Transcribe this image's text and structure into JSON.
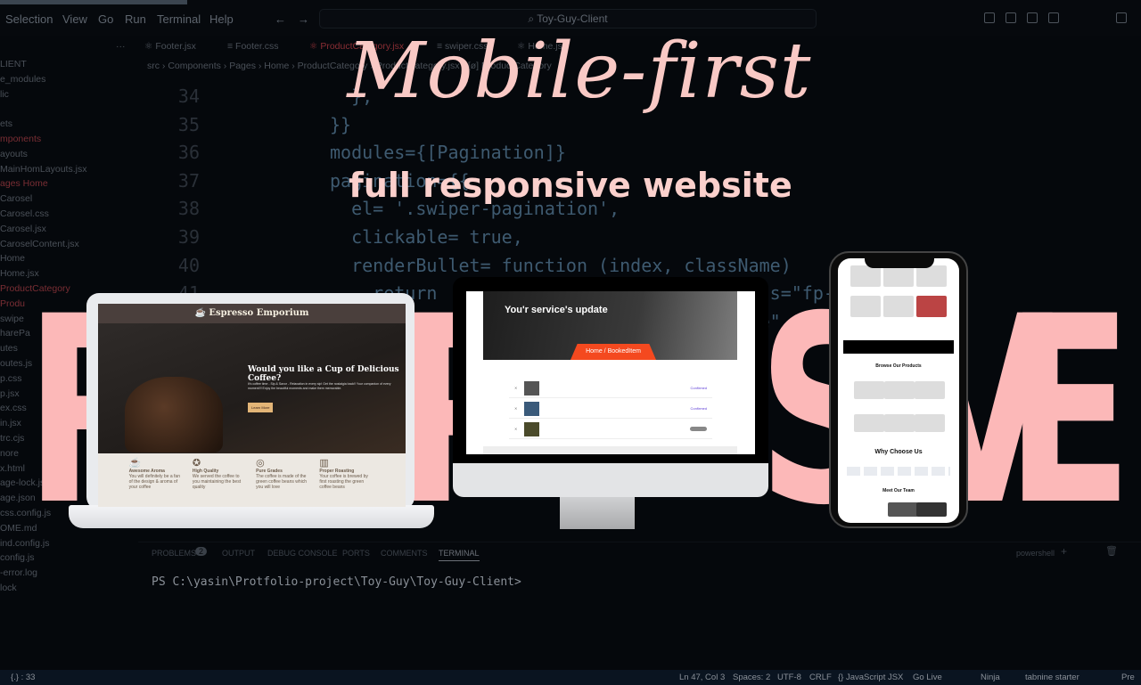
{
  "titlebar": {
    "menu": [
      "Selection",
      "View",
      "Go",
      "Run",
      "Terminal",
      "Help"
    ],
    "search": "Toy-Guy-Client"
  },
  "sidebar": {
    "more": "···",
    "items": [
      "LIENT",
      "e_modules",
      "lic",
      "",
      "ets",
      "mponents",
      "ayouts",
      "MainHomLayouts.jsx",
      "ages  Home",
      "Carosel",
      "Carosel.css",
      "Carosel.jsx",
      "CaroselContent.jsx",
      "Home",
      "Home.jsx",
      "ProductCategory",
      "Produ",
      "swipe",
      "harePa",
      "utes",
      "outes.js",
      "p.css",
      "p.jsx",
      "ex.css",
      "in.jsx",
      "trc.cjs",
      "nore",
      "x.html",
      "age-lock.json",
      "age.json",
      "css.config.js",
      "OME.md",
      "ind.config.js",
      "config.js",
      "-error.log",
      "lock"
    ]
  },
  "tabs": [
    "Footer.jsx",
    "Footer.css",
    "ProductCategory.jsx",
    "swiper.css",
    "Home.jsx"
  ],
  "breadcrumb": "src › Components › Pages › Home › ProductCategory › ProductCategory.jsx › [ø] ProductCategory",
  "code": {
    "lines": [
      "34",
      "35",
      "36",
      "37",
      "38",
      "39",
      "40",
      "41"
    ],
    "text": [
      "  },",
      "}}",
      "modules={[Pagination]}",
      "pagination={{",
      "  el= '.swiper-pagination',",
      "  clickable= true,",
      "  renderBullet= function (index, className)",
      "    return                   + '\">       s=\"fp-arc-loa",
      "    <cir                 \"8\" r=      none\" transfo",
      "                             op",
      "    cl                       FFF\"><",
      "    </",
      "",
      "  me=\"         "
    ]
  },
  "panel": {
    "tabs": [
      "PROBLEMS",
      "OUTPUT",
      "DEBUG CONSOLE",
      "PORTS",
      "COMMENTS",
      "TERMINAL"
    ],
    "problems_count": "2",
    "shell": "powershell",
    "prompt": "PS C:\\yasin\\Protfolio-project\\Toy-Guy\\Toy-Guy-Client>"
  },
  "status": {
    "left": "{.} : 33",
    "items": [
      "Ln 47, Col 3",
      "Spaces: 2",
      "UTF-8",
      "CRLF",
      "{} JavaScript JSX",
      "Go Live",
      "Ninja",
      "tabnine starter",
      "Pre"
    ]
  },
  "promo": {
    "headline": "Mobile-first",
    "subheadline": "full responsive website",
    "big_letters": [
      "R",
      "P",
      "S",
      "V",
      "E"
    ]
  },
  "laptop": {
    "brand": "Espresso Emporium",
    "hero_title": "Would you like a Cup of Delicious Coffee?",
    "hero_text": "It's coffee time - Sip & Savor - Relaxation in every sip! Get the nostalgia back!! Your companion of every moment!!! Enjoy the beautiful moments and make them memorable.",
    "button": "Learn More",
    "features": [
      {
        "title": "Awesome Aroma",
        "text": "You will definitely be a fan of the design & aroma of your coffee"
      },
      {
        "title": "High Quality",
        "text": "We served the coffee to you maintaining the best quality"
      },
      {
        "title": "Pure Grades",
        "text": "The coffee is made of the green coffee beans which you will love"
      },
      {
        "title": "Proper Roasting",
        "text": "Your coffee is brewed by first roasting the green coffee beans"
      }
    ]
  },
  "monitor": {
    "title": "You'r service's update",
    "breadcrumb": "Home / BookedItem",
    "rows": [
      {
        "status": "Confirmed"
      },
      {
        "status": "Confirmed"
      },
      {
        "status": "Pending"
      }
    ]
  },
  "phone": {
    "section1": "Browse Our Products",
    "section2": "Why Choose Us",
    "section3": "Meet Our Team"
  },
  "colors": {
    "accent": "#fcb8b8",
    "orange": "#f4491f",
    "bg": "#05080c"
  }
}
